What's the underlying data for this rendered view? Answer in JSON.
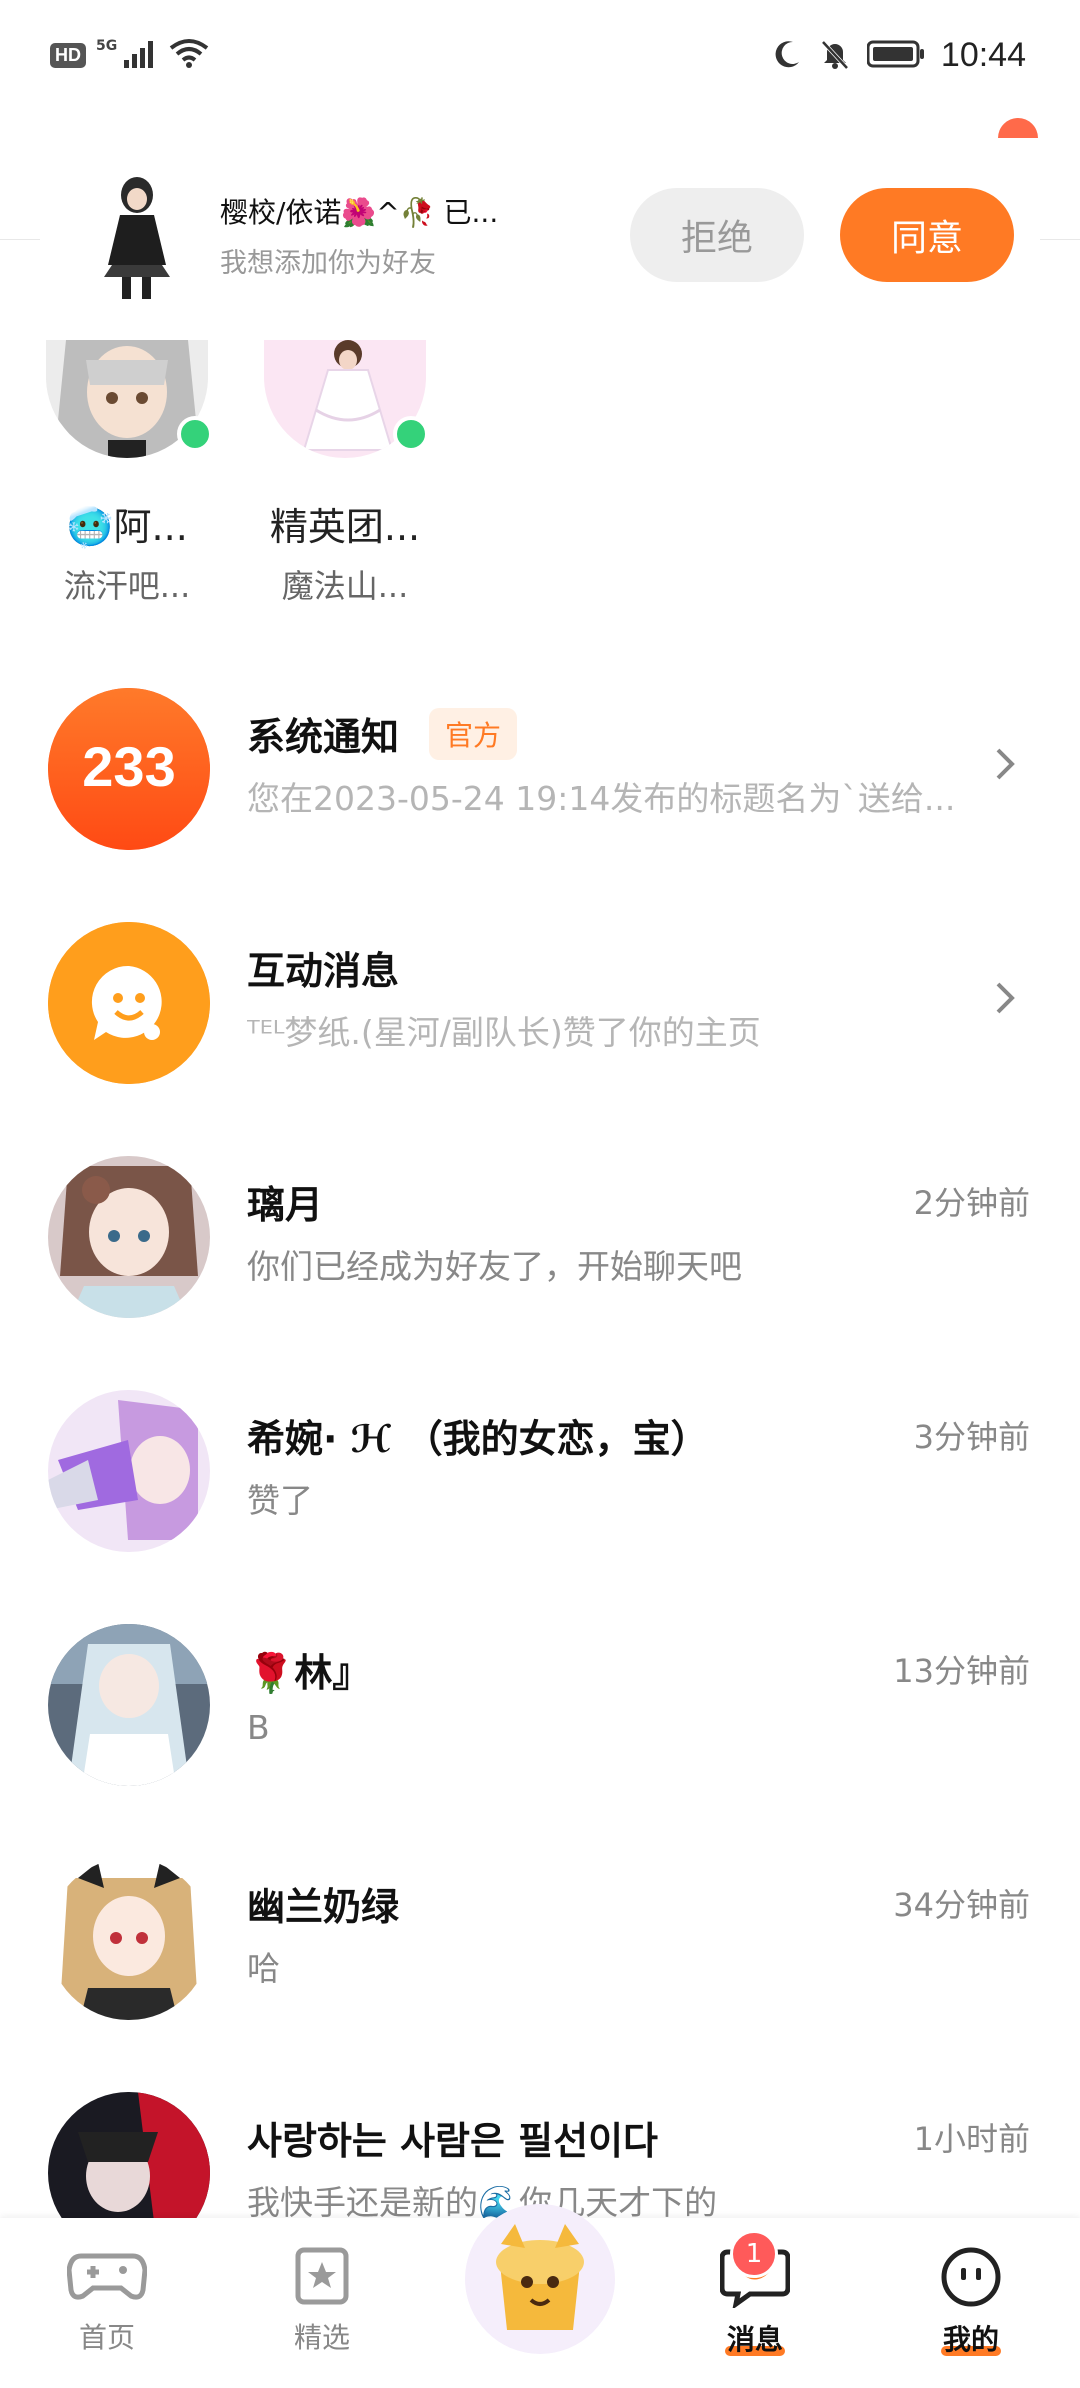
{
  "status_bar": {
    "hd": "HD",
    "network": "5G",
    "time": "10:44"
  },
  "request": {
    "name": "樱校/依诺🌺^🥀 已...",
    "subtitle": "我想添加你为好友",
    "reject_label": "拒绝",
    "accept_label": "同意"
  },
  "online_friends": [
    {
      "name": "🥶阿...",
      "sub": "流汗吧..."
    },
    {
      "name": "精英团...",
      "sub": "魔法山..."
    }
  ],
  "conversations": [
    {
      "title": "系统通知",
      "badge": "官方",
      "subtitle": "您在2023-05-24 19:14发布的标题名为`送给...",
      "time": ""
    },
    {
      "title": "互动消息",
      "subtitle": "ᵀᴱᴸ梦纸.(星河/副队长)赞了你的主页",
      "time": ""
    },
    {
      "title": "璃月",
      "subtitle": "你们已经成为好友了，开始聊天吧",
      "time": "2分钟前"
    },
    {
      "title": "希婉· ℋ （我的女恋，宝）",
      "subtitle": "赞了",
      "time": "3分钟前"
    },
    {
      "title": "🌹林』",
      "subtitle": "B",
      "time": "13分钟前"
    },
    {
      "title": "幽兰奶绿",
      "subtitle": "哈",
      "time": "34分钟前"
    },
    {
      "title": "사랑하는 사람은 필선이다",
      "subtitle": "我快手还是新的🌊你几天才下的",
      "time": "1小时前"
    }
  ],
  "system_logo_text": "233",
  "nav": {
    "home": "首页",
    "featured": "精选",
    "messages": "消息",
    "messages_badge": "1",
    "mine": "我的"
  },
  "colors": {
    "accent": "#ff7a24",
    "online": "#34d27a",
    "badge": "#ff5a5a"
  }
}
